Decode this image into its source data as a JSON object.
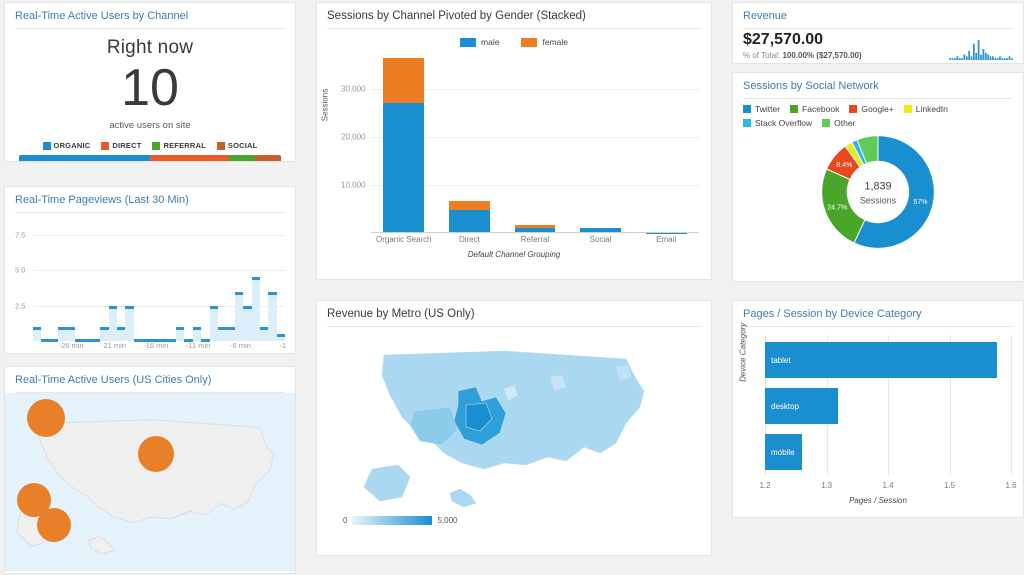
{
  "theme": {
    "page_bg": "#f1f1f1",
    "panel_bg": "#ffffff",
    "title_blue": "#3c7cb4",
    "accent_blue": "#1a8fcf",
    "accent_orange": "#ec7d23",
    "accent_green": "#4aa62a",
    "accent_red_orange": "#e8481c",
    "accent_yellow": "#ede81c",
    "accent_cyan": "#29b9e6",
    "accent_lightgreen": "#62ca5a"
  },
  "realtime_channel": {
    "title": "Real-Time Active Users by Channel",
    "right_now_label": "Right now",
    "count": "10",
    "subtitle": "active users on site",
    "legend": [
      {
        "label": "ORGANIC",
        "color": "#1a8fcf"
      },
      {
        "label": "DIRECT",
        "color": "#ec5b23"
      },
      {
        "label": "REFERRAL",
        "color": "#4aa62a"
      },
      {
        "label": "SOCIAL",
        "color": "#c4602a"
      }
    ],
    "segments": [
      {
        "label": "50%",
        "value": 50,
        "color": "#1a8fcf"
      },
      {
        "label": "30%",
        "value": 30,
        "color": "#ec5b23"
      },
      {
        "label": "10%",
        "value": 10,
        "color": "#4aa62a"
      },
      {
        "label": "10%",
        "value": 10,
        "color": "#c4602a"
      }
    ]
  },
  "realtime_pageviews": {
    "title": "Real-Time Pageviews (Last 30 Min)",
    "chart_data": {
      "type": "bar",
      "title": "Real-Time Pageviews (Last 30 Min)",
      "xlabel": "",
      "ylabel": "",
      "ylim": [
        0,
        8.5
      ],
      "yticks": [
        "2.5",
        "5.0",
        "7.5"
      ],
      "ytick_values": [
        2.5,
        5.0,
        7.5
      ],
      "grid": true,
      "xticks": [
        "-26 min",
        "-21 min",
        "-16 min",
        "-11 min",
        "-6 min",
        "-1"
      ],
      "xtick_positions": [
        4,
        9,
        14,
        19,
        24,
        29
      ],
      "categories": [
        "-30",
        "-29",
        "-28",
        "-27",
        "-26",
        "-25",
        "-24",
        "-23",
        "-22",
        "-21",
        "-20",
        "-19",
        "-18",
        "-17",
        "-16",
        "-15",
        "-14",
        "-13",
        "-12",
        "-11",
        "-10",
        "-9",
        "-8",
        "-7",
        "-6",
        "-5",
        "-4",
        "-3",
        "-2",
        "-1"
      ],
      "values": [
        1,
        0,
        0,
        1,
        1,
        0,
        0,
        0,
        1,
        2.5,
        1,
        2.5,
        0,
        0,
        0,
        0,
        0,
        1,
        0,
        1,
        0,
        2.5,
        1,
        1,
        3.5,
        2.5,
        4.5,
        1,
        3.5,
        0.5
      ]
    }
  },
  "realtime_cities": {
    "title": "Real-Time Active Users (US Cities Only)",
    "bubbles": [
      {
        "left_pct": 14,
        "top_pct": 14,
        "size": 38
      },
      {
        "left_pct": 52,
        "top_pct": 34,
        "size": 36
      },
      {
        "left_pct": 10,
        "top_pct": 60,
        "size": 34
      },
      {
        "left_pct": 17,
        "top_pct": 74,
        "size": 34
      }
    ]
  },
  "sessions_stacked": {
    "title": "Sessions by Channel Pivoted by Gender (Stacked)",
    "chart_data": {
      "type": "bar",
      "title": "Sessions by Channel Pivoted by Gender (Stacked)",
      "stacked": true,
      "xlabel": "Default Channel Grouping",
      "ylabel": "Sessions",
      "ylim": [
        0,
        40000
      ],
      "yticks": [
        "10,000",
        "20,000",
        "30,000"
      ],
      "ytick_values": [
        10000,
        20000,
        30000
      ],
      "grid": true,
      "legend_position": "top-center",
      "categories": [
        "Organic Search",
        "Direct",
        "Referral",
        "Social",
        "Email"
      ],
      "series": [
        {
          "name": "male",
          "color": "#1a8fcf",
          "values": [
            27000,
            4800,
            1100,
            1000,
            60
          ]
        },
        {
          "name": "female",
          "color": "#ec7d23",
          "values": [
            9500,
            1800,
            500,
            60,
            40
          ]
        }
      ]
    }
  },
  "revenue_metro": {
    "title": "Revenue by Metro (US Only)",
    "chart_data": {
      "type": "heatmap",
      "title": "Revenue by Metro (US Only)",
      "legend_min": "0",
      "legend_max": "5,000",
      "scale_min": 0,
      "scale_max": 5000,
      "colormap_low": "#e8f4fb",
      "colormap_high": "#1a8fcf"
    }
  },
  "revenue": {
    "title": "Revenue",
    "value": "$27,570.00",
    "pct_prefix": "% of Total:",
    "pct_value": "100.00%",
    "pct_amount": "($27,570.00)",
    "sparkline": [
      1,
      1,
      1,
      2,
      1,
      1,
      3,
      2,
      5,
      2,
      9,
      4,
      11,
      3,
      6,
      4,
      3,
      2,
      2,
      1,
      1,
      2,
      1,
      1,
      1,
      2,
      1
    ]
  },
  "social_network": {
    "title": "Sessions by Social Network",
    "chart_data": {
      "type": "pie",
      "title": "Sessions by Social Network",
      "donut": true,
      "center_value": "1,839",
      "center_label": "Sessions",
      "total": 1839,
      "legend_position": "top-left",
      "labels": [
        "Twitter",
        "Facebook",
        "Google+",
        "LinkedIn",
        "Stack Overflow",
        "Other"
      ],
      "values": [
        57,
        24.7,
        8.4,
        2.2,
        1.6,
        6.1
      ],
      "colors": [
        "#1a8fcf",
        "#4aa62a",
        "#e8481c",
        "#ede81c",
        "#29b9e6",
        "#62ca5a"
      ],
      "data_labels": [
        "57%",
        "24.7%",
        "8.4%",
        "",
        "",
        ""
      ]
    }
  },
  "device_category": {
    "title": "Pages / Session by Device Category",
    "chart_data": {
      "type": "bar",
      "orientation": "horizontal",
      "title": "Pages / Session by Device Category",
      "xlabel": "Pages / Session",
      "ylabel": "Device Category",
      "xlim": [
        1.2,
        1.6
      ],
      "xticks": [
        "1.2",
        "1.3",
        "1.4",
        "1.5",
        "1.6"
      ],
      "xtick_values": [
        1.2,
        1.3,
        1.4,
        1.5,
        1.6
      ],
      "grid": true,
      "categories": [
        "tablet",
        "desktop",
        "mobile"
      ],
      "values": [
        1.58,
        1.32,
        1.26
      ],
      "color": "#1a8fcf"
    }
  }
}
